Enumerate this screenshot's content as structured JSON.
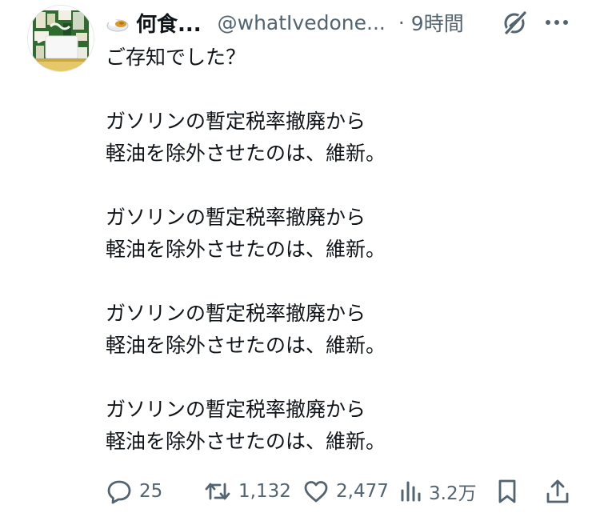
{
  "tweet": {
    "author": {
      "display_name": "何食...",
      "handle": "@whatIvedone...",
      "emoji_icon": "curry-rice-emoji",
      "avatar": "cup-noodle-avatar"
    },
    "separator": "·",
    "time": "9時間",
    "header_icons": [
      "grok-icon",
      "more-icon"
    ],
    "paragraphs": [
      "ご存知でした？",
      "ガソリンの暫定税率撤廃から\n軽油を除外させたのは、維新。",
      "ガソリンの暫定税率撤廃から\n軽油を除外させたのは、維新。",
      "ガソリンの暫定税率撤廃から\n軽油を除外させたのは、維新。",
      "ガソリンの暫定税率撤廃から\n軽油を除外させたのは、維新。"
    ],
    "actions": {
      "reply": {
        "icon": "reply-icon",
        "count": "25"
      },
      "repost": {
        "icon": "repost-icon",
        "count": "1,132"
      },
      "like": {
        "icon": "heart-icon",
        "count": "2,477"
      },
      "views": {
        "icon": "views-icon",
        "count": "3.2万"
      },
      "bookmark": {
        "icon": "bookmark-icon"
      },
      "share": {
        "icon": "share-icon"
      }
    }
  },
  "colors": {
    "text": "#0f1419",
    "secondary": "#536471",
    "background": "#ffffff"
  }
}
